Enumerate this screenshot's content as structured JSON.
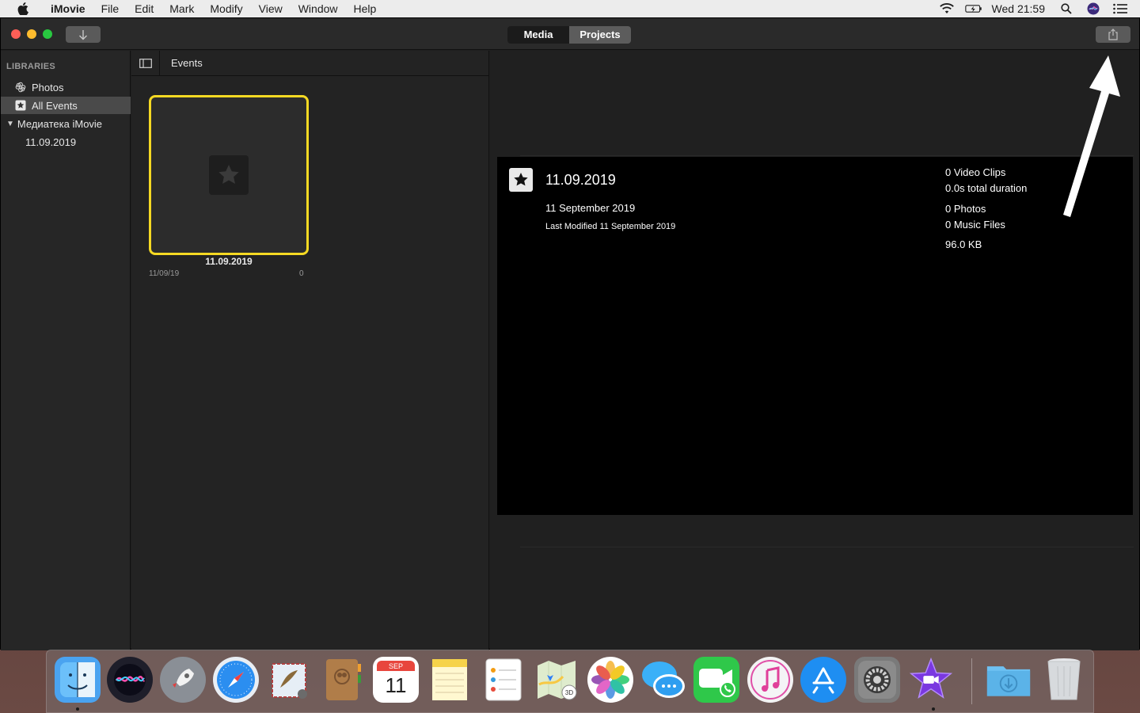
{
  "menubar": {
    "app_name": "iMovie",
    "items": [
      "File",
      "Edit",
      "Mark",
      "Modify",
      "View",
      "Window",
      "Help"
    ],
    "clock": "Wed 21:59"
  },
  "toolbar": {
    "segments": [
      "Media",
      "Projects"
    ],
    "selected_segment": "Media"
  },
  "sidebar": {
    "header": "LIBRARIES",
    "items": [
      {
        "label": "Photos",
        "icon": "photos-flower-icon"
      },
      {
        "label": "All Events",
        "icon": "star-box-icon",
        "selected": true
      },
      {
        "label": "Медиатека iMovie",
        "icon": "disclosure-triangle-icon"
      },
      {
        "label": "11.09.2019",
        "icon": ""
      }
    ]
  },
  "events": {
    "title": "Events",
    "card": {
      "name": "11.09.2019",
      "date": "11/09/19",
      "count": "0"
    }
  },
  "info": {
    "title": "11.09.2019",
    "date": "11 September 2019",
    "modified": "Last Modified 11 September 2019",
    "stats": {
      "video_clips": "0 Video Clips",
      "duration": "0.0s total duration",
      "photos": "0 Photos",
      "music": "0 Music Files",
      "size": "96.0 KB"
    }
  },
  "dock": {
    "apps": [
      {
        "name": "finder",
        "color": "#4aa3f0"
      },
      {
        "name": "siri",
        "color": "#2a2a3a"
      },
      {
        "name": "launchpad",
        "color": "#8a8f96"
      },
      {
        "name": "safari",
        "color": "#2b8ef0"
      },
      {
        "name": "mail",
        "color": "#cfe3f5"
      },
      {
        "name": "contacts",
        "color": "#b5834e"
      },
      {
        "name": "calendar",
        "color": "#ffffff",
        "month": "SEP",
        "day": "11"
      },
      {
        "name": "notes",
        "color": "#f6df6a"
      },
      {
        "name": "reminders",
        "color": "#ffffff"
      },
      {
        "name": "maps",
        "color": "#e7f0d8"
      },
      {
        "name": "photos",
        "color": "#ffffff"
      },
      {
        "name": "messages",
        "color": "#2fa7f5"
      },
      {
        "name": "facetime",
        "color": "#2fc84a"
      },
      {
        "name": "itunes",
        "color": "#f2f2f2"
      },
      {
        "name": "app-store",
        "color": "#1e8ef2"
      },
      {
        "name": "system-preferences",
        "color": "#7a7a7a"
      },
      {
        "name": "imovie",
        "color": "#6b2bd0"
      },
      {
        "name": "downloads-folder",
        "color": "#5bb3e8"
      },
      {
        "name": "trash",
        "color": "#d9dcdf"
      }
    ]
  },
  "colors": {
    "selection_yellow": "#f5d923",
    "window_bg": "#1f1f1f",
    "info_panel_bg": "#000000"
  }
}
